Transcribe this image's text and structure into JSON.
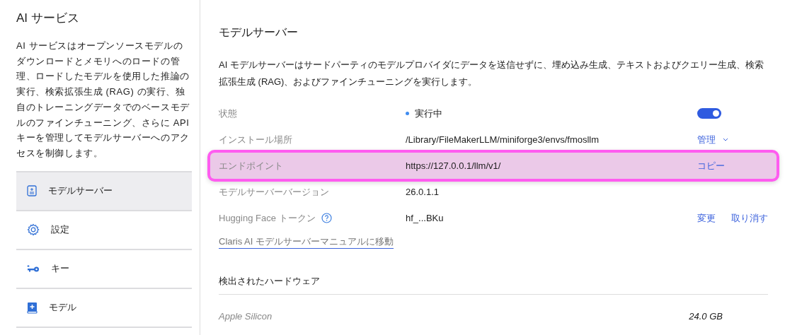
{
  "sidebar": {
    "title": "AI サービス",
    "description": "AI サービスはオープンソースモデルのダウンロードとメモリへのロードの管理、ロードしたモデルを使用した推論の実行、検索拡張生成 (RAG) の実行、独自のトレーニングデータでのベースモデルのファインチューニング、さらに API キーを管理してモデルサーバーへのアクセスを制御します。",
    "items": [
      {
        "label": "モデルサーバー",
        "selected": true
      },
      {
        "label": "設定",
        "selected": false
      },
      {
        "label": "キー",
        "selected": false
      },
      {
        "label": "モデル",
        "selected": false
      }
    ]
  },
  "main": {
    "title": "モデルサーバー",
    "description": "AI モデルサーバーはサードパーティのモデルプロバイダにデータを送信せずに、埋め込み生成、テキストおよびクエリー生成、検索拡張生成 (RAG)、およびファインチューニングを実行します。",
    "rows": [
      {
        "label": "状態",
        "value": "実行中",
        "kind": "status",
        "help": false,
        "highlighted": false,
        "toggle": {
          "on": true
        },
        "actions": []
      },
      {
        "label": "インストール場所",
        "value": "/Library/FileMakerLLM/miniforge3/envs/fmosllm",
        "kind": "text",
        "help": false,
        "highlighted": false,
        "actions": [
          {
            "label": "管理",
            "dropdown": true
          }
        ]
      },
      {
        "label": "エンドポイント",
        "value": "https://127.0.0.1/llm/v1/",
        "kind": "text",
        "help": false,
        "highlighted": true,
        "actions": [
          {
            "label": "コピー",
            "dropdown": false
          }
        ]
      },
      {
        "label": "モデルサーバーバージョン",
        "value": "26.0.1.1",
        "kind": "text",
        "help": false,
        "highlighted": false,
        "actions": []
      },
      {
        "label": "Hugging Face トークン",
        "value": "hf_...BKu",
        "kind": "text",
        "help": true,
        "highlighted": false,
        "actions": [
          {
            "label": "変更",
            "dropdown": false
          },
          {
            "label": "取り消す",
            "dropdown": false
          }
        ]
      }
    ],
    "link": "Claris AI モデルサーバーマニュアルに移動",
    "hardware": {
      "title": "検出されたハードウェア",
      "rows": [
        {
          "name": "Apple Silicon",
          "memory": "24.0 GB"
        }
      ]
    }
  }
}
